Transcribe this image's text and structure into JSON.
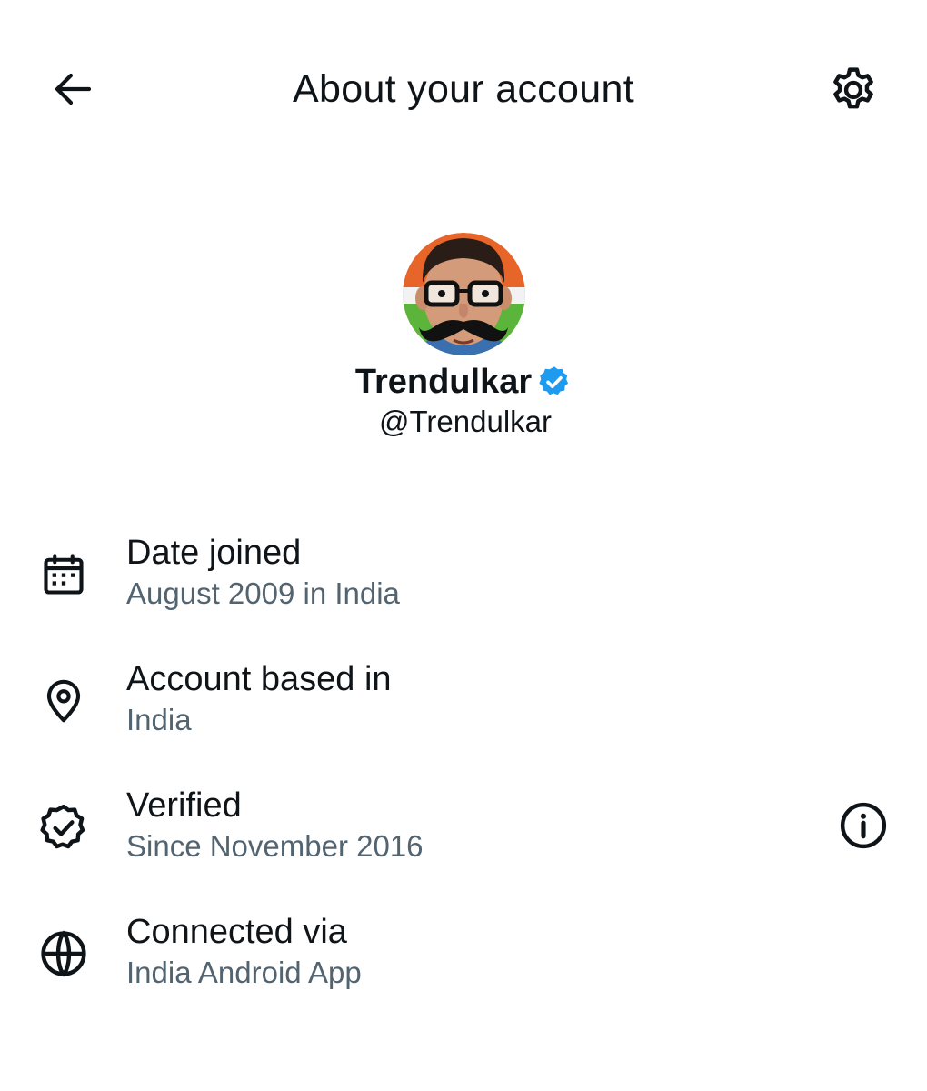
{
  "header": {
    "title": "About your account",
    "back_icon": "arrow-left-icon",
    "settings_icon": "gear-icon"
  },
  "profile": {
    "display_name": "Trendulkar",
    "handle": "@Trendulkar",
    "verified": true,
    "verified_badge_color": "#1d9bf0",
    "avatar_icon": "avatar-caricature"
  },
  "info_rows": [
    {
      "icon": "calendar-icon",
      "label": "Date joined",
      "value": "August 2009 in India"
    },
    {
      "icon": "location-pin-icon",
      "label": "Account based in",
      "value": "India"
    },
    {
      "icon": "verified-badge-icon",
      "label": "Verified",
      "value": "Since November 2016",
      "trailing_icon": "info-icon"
    },
    {
      "icon": "globe-icon",
      "label": "Connected via",
      "value": "India Android App"
    }
  ],
  "colors": {
    "text_primary": "#0f1419",
    "text_secondary": "#536471",
    "accent": "#1d9bf0",
    "background": "#ffffff"
  }
}
